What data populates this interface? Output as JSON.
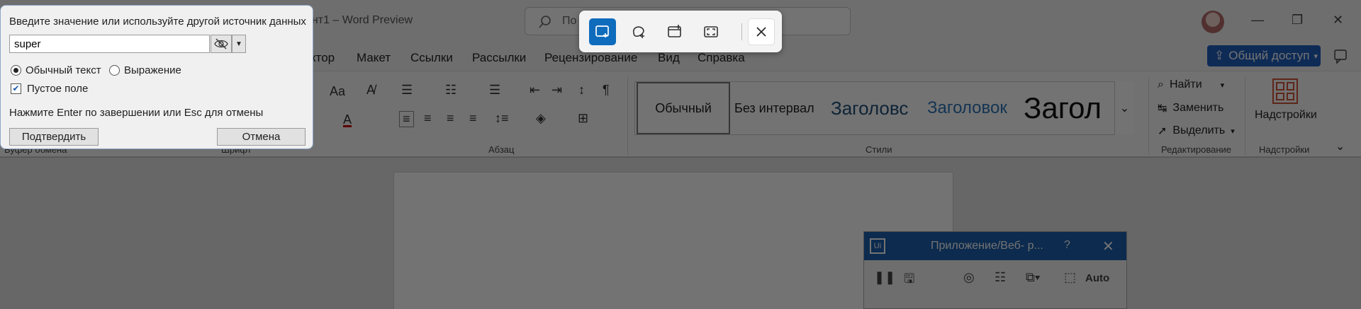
{
  "word": {
    "title_fragment": "ент1 – Word Preview",
    "search_placeholder": "По",
    "tabs": [
      "ктор",
      "Макет",
      "Ссылки",
      "Рассылки",
      "Рецензирование",
      "Вид",
      "Справка"
    ],
    "share_label": "Общий доступ",
    "group_labels": {
      "clipboard": "Буфер обмена",
      "font": "Шрифт",
      "paragraph": "Абзац",
      "styles": "Стили",
      "editing": "Редактирование",
      "addins": "Надстройки"
    },
    "styles": [
      "Обычный",
      "Без интервал",
      "Заголовс",
      "Заголовок",
      "Загол"
    ],
    "editing": {
      "find": "Найти",
      "replace": "Заменить",
      "select": "Выделить"
    },
    "addins_label": "Надстройки",
    "font_case_label": "Aa"
  },
  "snip_toolbar": {
    "modes": [
      "rectangle-snip",
      "freeform-snip",
      "window-snip",
      "fullscreen-snip"
    ],
    "active_mode": "rectangle-snip",
    "accent": "#0f6cbd"
  },
  "dialog": {
    "prompt": "Введите значение или используйте другой источник данных",
    "input_value": "super",
    "radio_plain": "Обычный текст",
    "radio_expression": "Выражение",
    "radio_selected": "Обычный текст",
    "checkbox_label": "Пустое поле",
    "checkbox_checked": true,
    "hint": "Нажмите Enter по завершении или Esc для отмены",
    "confirm_label": "Подтвердить",
    "cancel_label": "Отмена"
  },
  "ui_panel": {
    "logo": "Ui",
    "title": "Приложение/Веб- р...",
    "help": "?",
    "auto_label": "Auto"
  }
}
